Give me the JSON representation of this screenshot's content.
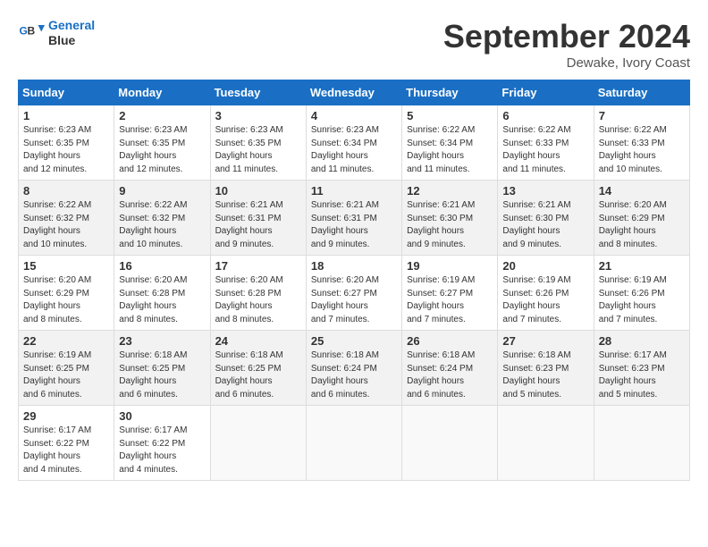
{
  "header": {
    "logo_line1": "General",
    "logo_line2": "Blue",
    "month": "September 2024",
    "location": "Dewake, Ivory Coast"
  },
  "days_of_week": [
    "Sunday",
    "Monday",
    "Tuesday",
    "Wednesday",
    "Thursday",
    "Friday",
    "Saturday"
  ],
  "weeks": [
    [
      {
        "day": "1",
        "sunrise": "6:23 AM",
        "sunset": "6:35 PM",
        "daylight": "12 hours and 12 minutes."
      },
      {
        "day": "2",
        "sunrise": "6:23 AM",
        "sunset": "6:35 PM",
        "daylight": "12 hours and 12 minutes."
      },
      {
        "day": "3",
        "sunrise": "6:23 AM",
        "sunset": "6:35 PM",
        "daylight": "12 hours and 11 minutes."
      },
      {
        "day": "4",
        "sunrise": "6:23 AM",
        "sunset": "6:34 PM",
        "daylight": "12 hours and 11 minutes."
      },
      {
        "day": "5",
        "sunrise": "6:22 AM",
        "sunset": "6:34 PM",
        "daylight": "12 hours and 11 minutes."
      },
      {
        "day": "6",
        "sunrise": "6:22 AM",
        "sunset": "6:33 PM",
        "daylight": "12 hours and 11 minutes."
      },
      {
        "day": "7",
        "sunrise": "6:22 AM",
        "sunset": "6:33 PM",
        "daylight": "12 hours and 10 minutes."
      }
    ],
    [
      {
        "day": "8",
        "sunrise": "6:22 AM",
        "sunset": "6:32 PM",
        "daylight": "12 hours and 10 minutes."
      },
      {
        "day": "9",
        "sunrise": "6:22 AM",
        "sunset": "6:32 PM",
        "daylight": "12 hours and 10 minutes."
      },
      {
        "day": "10",
        "sunrise": "6:21 AM",
        "sunset": "6:31 PM",
        "daylight": "12 hours and 9 minutes."
      },
      {
        "day": "11",
        "sunrise": "6:21 AM",
        "sunset": "6:31 PM",
        "daylight": "12 hours and 9 minutes."
      },
      {
        "day": "12",
        "sunrise": "6:21 AM",
        "sunset": "6:30 PM",
        "daylight": "12 hours and 9 minutes."
      },
      {
        "day": "13",
        "sunrise": "6:21 AM",
        "sunset": "6:30 PM",
        "daylight": "12 hours and 9 minutes."
      },
      {
        "day": "14",
        "sunrise": "6:20 AM",
        "sunset": "6:29 PM",
        "daylight": "12 hours and 8 minutes."
      }
    ],
    [
      {
        "day": "15",
        "sunrise": "6:20 AM",
        "sunset": "6:29 PM",
        "daylight": "12 hours and 8 minutes."
      },
      {
        "day": "16",
        "sunrise": "6:20 AM",
        "sunset": "6:28 PM",
        "daylight": "12 hours and 8 minutes."
      },
      {
        "day": "17",
        "sunrise": "6:20 AM",
        "sunset": "6:28 PM",
        "daylight": "12 hours and 8 minutes."
      },
      {
        "day": "18",
        "sunrise": "6:20 AM",
        "sunset": "6:27 PM",
        "daylight": "12 hours and 7 minutes."
      },
      {
        "day": "19",
        "sunrise": "6:19 AM",
        "sunset": "6:27 PM",
        "daylight": "12 hours and 7 minutes."
      },
      {
        "day": "20",
        "sunrise": "6:19 AM",
        "sunset": "6:26 PM",
        "daylight": "12 hours and 7 minutes."
      },
      {
        "day": "21",
        "sunrise": "6:19 AM",
        "sunset": "6:26 PM",
        "daylight": "12 hours and 7 minutes."
      }
    ],
    [
      {
        "day": "22",
        "sunrise": "6:19 AM",
        "sunset": "6:25 PM",
        "daylight": "12 hours and 6 minutes."
      },
      {
        "day": "23",
        "sunrise": "6:18 AM",
        "sunset": "6:25 PM",
        "daylight": "12 hours and 6 minutes."
      },
      {
        "day": "24",
        "sunrise": "6:18 AM",
        "sunset": "6:25 PM",
        "daylight": "12 hours and 6 minutes."
      },
      {
        "day": "25",
        "sunrise": "6:18 AM",
        "sunset": "6:24 PM",
        "daylight": "12 hours and 6 minutes."
      },
      {
        "day": "26",
        "sunrise": "6:18 AM",
        "sunset": "6:24 PM",
        "daylight": "12 hours and 6 minutes."
      },
      {
        "day": "27",
        "sunrise": "6:18 AM",
        "sunset": "6:23 PM",
        "daylight": "12 hours and 5 minutes."
      },
      {
        "day": "28",
        "sunrise": "6:17 AM",
        "sunset": "6:23 PM",
        "daylight": "12 hours and 5 minutes."
      }
    ],
    [
      {
        "day": "29",
        "sunrise": "6:17 AM",
        "sunset": "6:22 PM",
        "daylight": "12 hours and 4 minutes."
      },
      {
        "day": "30",
        "sunrise": "6:17 AM",
        "sunset": "6:22 PM",
        "daylight": "12 hours and 4 minutes."
      },
      null,
      null,
      null,
      null,
      null
    ]
  ]
}
